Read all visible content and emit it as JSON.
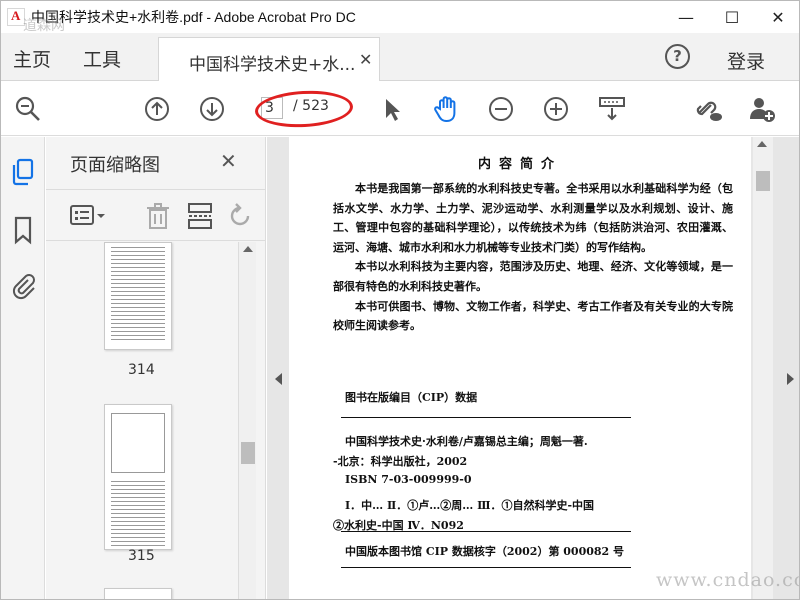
{
  "window": {
    "title": "中国科学技术史+水利卷.pdf - Adobe Acrobat Pro DC",
    "minimize": "—",
    "maximize": "☐",
    "close": "✕"
  },
  "menu": {
    "home": "主页",
    "tools": "工具",
    "tab_label": "中国科学技术史+水...",
    "tab_close": "✕",
    "help": "?",
    "login": "登录"
  },
  "toolbar": {
    "page_current": "3",
    "page_total": "/ 523",
    "icons": [
      "zoom-out-icon",
      "page-up-icon",
      "page-down-icon",
      "select-arrow-icon",
      "hand-tool-icon",
      "minus-zoom-icon",
      "plus-zoom-icon",
      "scroll-mode-icon",
      "share-link-icon",
      "add-user-icon"
    ],
    "accent": "#1473e6",
    "highlight": "#e02020"
  },
  "panel": {
    "title": "页面缩略图",
    "close": "✕",
    "thumbnails": [
      {
        "number": "314"
      },
      {
        "number": "315"
      }
    ]
  },
  "document": {
    "heading": "内容简介",
    "paragraphs": [
      "本书是我国第一部系统的水利科技史专著。全书采用以水利基础科学为经（包括水文学、水力学、土力学、泥沙运动学、水利测量学以及水利规划、设计、施工、管理中包容的基础科学理论），以传统技术为纬（包括防洪治河、农田灌溉、运河、海塘、城市水利和水力机械等专业技术门类）的写作结构。",
      "本书以水利科技为主要内容，范围涉及历史、地理、经济、文化等领域，是一部很有特色的水利科技史著作。",
      "本书可供图书、博物、文物工作者，科学史、考古工作者及有关专业的大专院校师生阅读参考。"
    ],
    "cip_title": "图书在版编目（CIP）数据",
    "cip_lines": [
      "中国科学技术史·水利卷/卢嘉锡总主编；周魁一著.",
      "-北京：科学出版社，2002",
      "ISBN 7-03-009999-0",
      "Ⅰ．中…   Ⅱ．①卢…②周…   Ⅲ．①自然科学史-中国",
      "②水利史-中国   Ⅳ．N092",
      "中国版本图书馆 CIP 数据核字（2002）第 000082 号"
    ]
  },
  "watermarks": {
    "top_left": "道森网",
    "bottom_right": "www.cndao.com"
  }
}
